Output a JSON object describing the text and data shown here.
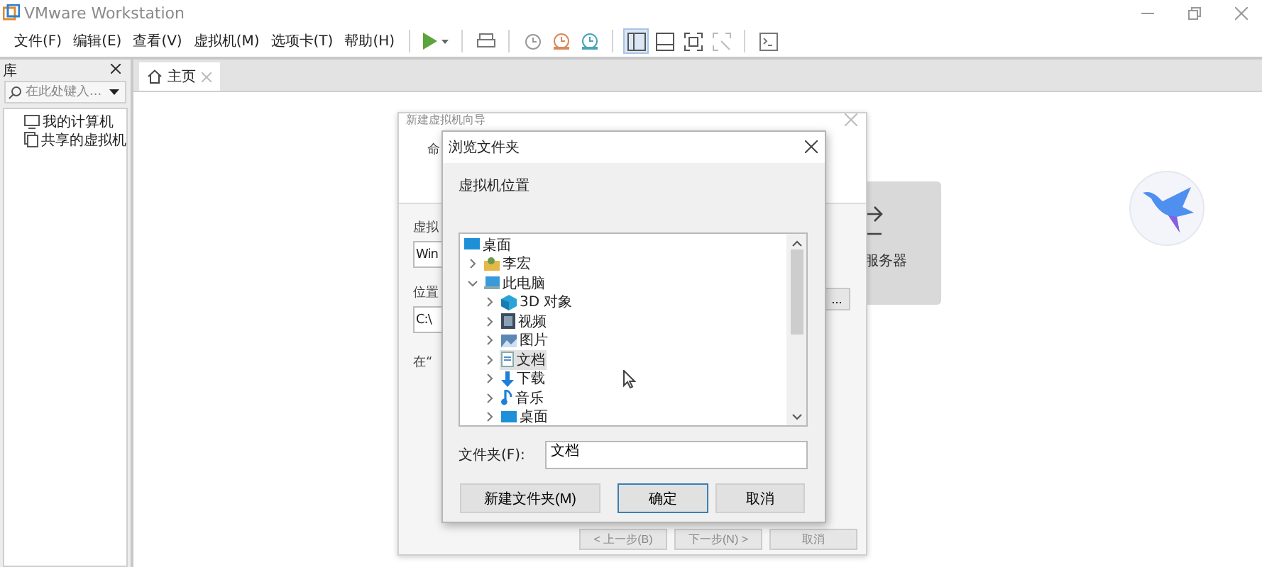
{
  "window": {
    "title": "VMware Workstation"
  },
  "menu": [
    "文件(F)",
    "编辑(E)",
    "查看(V)",
    "虚拟机(M)",
    "选项卡(T)",
    "帮助(H)"
  ],
  "toolbar": [
    {
      "kind": "play"
    },
    {
      "kind": "separator"
    },
    {
      "kind": "send-keys"
    },
    {
      "kind": "separator"
    },
    {
      "kind": "snapshot"
    },
    {
      "kind": "snapshot-revert"
    },
    {
      "kind": "snapshot-manager"
    },
    {
      "kind": "separator"
    },
    {
      "kind": "library-view",
      "selected": true
    },
    {
      "kind": "thumbnail-view",
      "selected": false
    },
    {
      "kind": "fullscreen",
      "selected": false
    },
    {
      "kind": "unity",
      "selected": false
    },
    {
      "kind": "separator"
    },
    {
      "kind": "console"
    }
  ],
  "library": {
    "title": "库",
    "search": {
      "placeholder": "在此处键入..."
    },
    "items": [
      {
        "label": "我的计算机",
        "kind": "computer"
      },
      {
        "label": "共享的虚拟机",
        "kind": "shared"
      }
    ]
  },
  "tabs": [
    {
      "label": "主页",
      "selected": true
    }
  ],
  "home": {
    "card_label": "服务器"
  },
  "wizard": {
    "title": "新建虚拟机向导",
    "heading": "命",
    "name_label": "虚拟",
    "name_value": "Win",
    "location_label": "位置",
    "location_value": "C:\\",
    "hint": "在“",
    "browse_button": "...",
    "buttons": [
      "< 上一步(B)",
      "下一步(N) >",
      "取消"
    ]
  },
  "browse": {
    "title": "浏览文件夹",
    "prompt": "虚拟机位置",
    "tree": [
      {
        "label": "桌面",
        "kind": "desktop",
        "selected": false,
        "children": [
          {
            "label": "李宏",
            "kind": "user",
            "selected": false,
            "expanded": false
          },
          {
            "label": "此电脑",
            "kind": "pc",
            "selected": false,
            "expanded": true,
            "children": [
              {
                "label": "3D 对象",
                "kind": "objects",
                "selected": false,
                "expanded": false
              },
              {
                "label": "视频",
                "kind": "video",
                "selected": false,
                "expanded": false
              },
              {
                "label": "图片",
                "kind": "pictures",
                "selected": false,
                "expanded": false
              },
              {
                "label": "文档",
                "kind": "documents",
                "selected": true,
                "expanded": false
              },
              {
                "label": "下载",
                "kind": "downloads",
                "selected": false,
                "expanded": false
              },
              {
                "label": "音乐",
                "kind": "music",
                "selected": false,
                "expanded": false
              },
              {
                "label": "桌面",
                "kind": "desktop",
                "selected": false,
                "expanded": false
              }
            ]
          }
        ]
      }
    ],
    "folder_label": "文件夹(F):",
    "folder_value": "文档",
    "buttons": [
      {
        "label": "新建文件夹(M)",
        "kind": "new-folder"
      },
      {
        "label": "确定",
        "kind": "default"
      },
      {
        "label": "取消",
        "kind": "cancel"
      }
    ]
  }
}
